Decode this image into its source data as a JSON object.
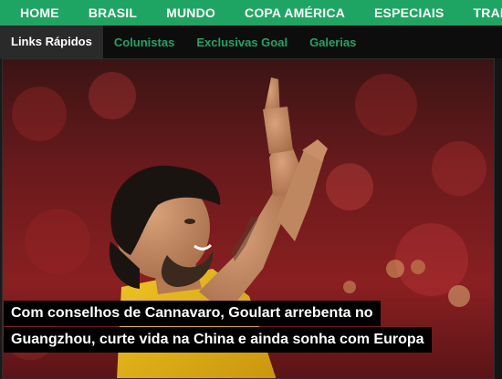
{
  "topnav": {
    "items": [
      "HOME",
      "BRASIL",
      "MUNDO",
      "COPA AMÉRICA",
      "ESPECIAIS",
      "TRANSFERÊNCIAS"
    ]
  },
  "subnav": {
    "active": "Links Rápidos",
    "links": [
      "Colunistas",
      "Exclusivas Goal",
      "Galerias"
    ]
  },
  "hero": {
    "image": "player-celebrating-photo",
    "headline_line1": "Com conselhos de Cannavaro, Goulart arrebenta no",
    "headline_line2": "Guangzhou, curte vida na China e ainda sonha com Europa"
  },
  "colors": {
    "nav_green": "#1fa563",
    "subnav_bg": "#0d0d0d",
    "headline_bg": "#000000",
    "stadium_red": "#8a1c1f",
    "jersey_yellow": "#e8b713"
  }
}
